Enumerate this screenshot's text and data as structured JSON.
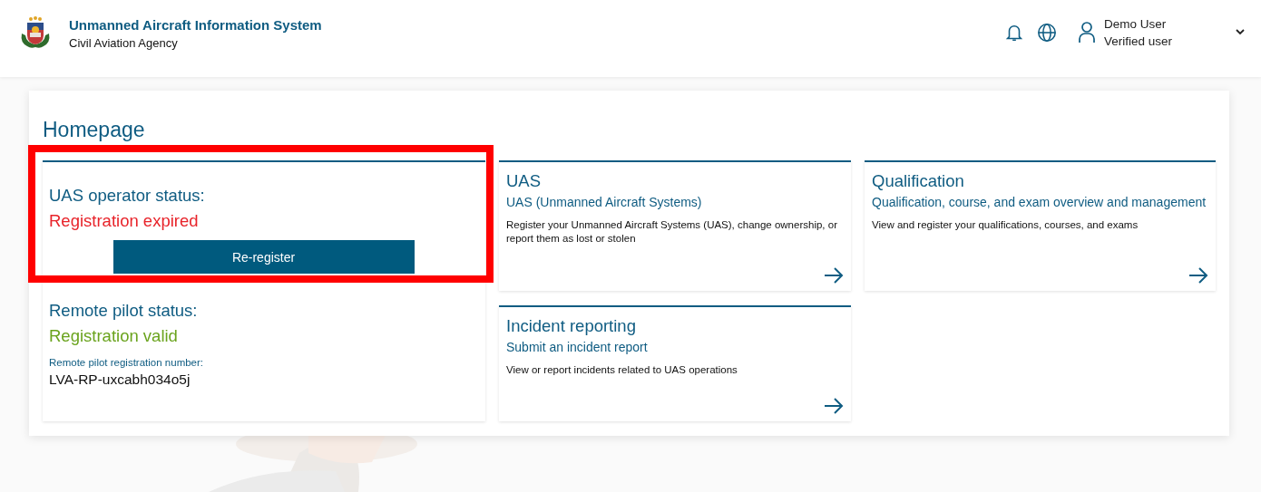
{
  "header": {
    "title": "Unmanned Aircraft Information System",
    "subtitle": "Civil Aviation Agency",
    "user": {
      "name": "Demo User",
      "role": "Verified user"
    }
  },
  "page_title": "Homepage",
  "status_card": {
    "sections": [
      {
        "label": "UAS operator status:",
        "status": "Registration expired",
        "kind": "expired",
        "highlighted": true,
        "button": "Re-register"
      },
      {
        "label": "Remote pilot status:",
        "status": "Registration valid",
        "kind": "valid",
        "highlighted": false,
        "number_label": "Remote pilot registration number:",
        "number": "LVA-RP-uxcabh034o5j"
      }
    ]
  },
  "service_cards": [
    {
      "title": "UAS",
      "subtitle": "UAS (Unmanned Aircraft Systems)",
      "description": "Register your Unmanned Aircraft Systems (UAS), change ownership, or report them as lost or stolen"
    },
    {
      "title": "Qualification",
      "subtitle": "Qualification, course, and exam overview and management",
      "description": "View and register your qualifications, courses, and exams"
    },
    {
      "title": "Incident reporting",
      "subtitle": "Submit an incident report",
      "description": "View or report incidents related to UAS operations"
    }
  ]
}
